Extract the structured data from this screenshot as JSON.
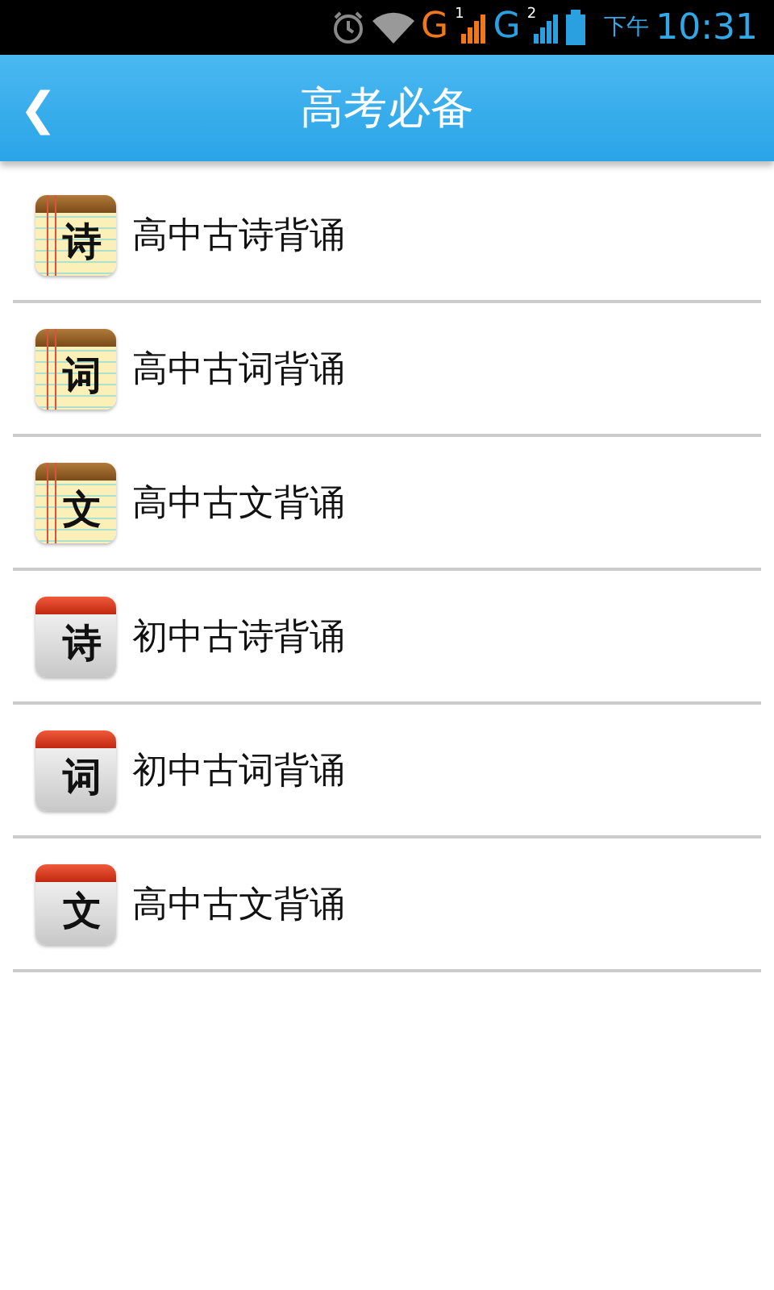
{
  "status_bar": {
    "network_1": "G",
    "sim_1": "1",
    "network_2": "G",
    "sim_2": "2",
    "period": "下午",
    "time": "10:31"
  },
  "header": {
    "back": "❮",
    "title": "高考必备"
  },
  "items": [
    {
      "kind": "notepad",
      "glyph": "诗",
      "label": "高中古诗背诵"
    },
    {
      "kind": "notepad",
      "glyph": "词",
      "label": "高中古词背诵"
    },
    {
      "kind": "notepad",
      "glyph": "文",
      "label": "高中古文背诵"
    },
    {
      "kind": "calendar",
      "glyph": "诗",
      "label": "初中古诗背诵"
    },
    {
      "kind": "calendar",
      "glyph": "词",
      "label": "初中古词背诵"
    },
    {
      "kind": "calendar",
      "glyph": "文",
      "label": "高中古文背诵"
    }
  ]
}
